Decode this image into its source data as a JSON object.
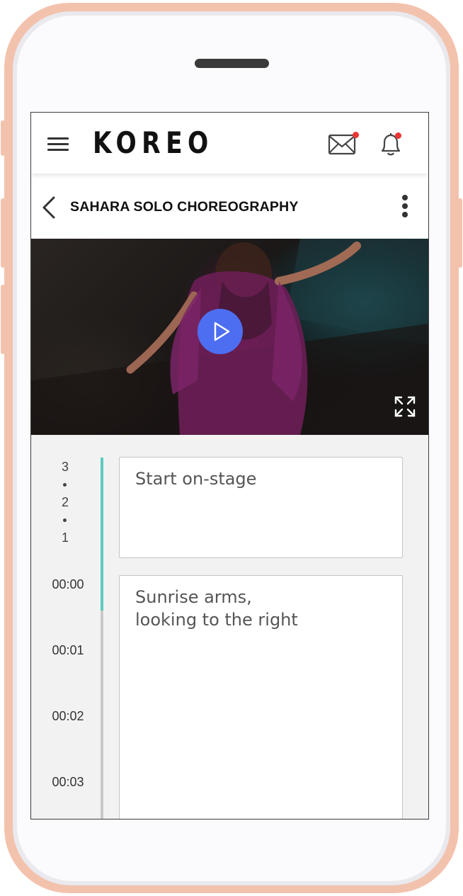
{
  "app": {
    "logo": "KOREO",
    "brand_color": "#111111"
  },
  "header": {
    "menu_icon": "hamburger-icon",
    "mail_icon": "mail-icon",
    "bell_icon": "bell-icon",
    "notification_dot_color": "#ea3535"
  },
  "page": {
    "title": "SAHARA SOLO CHOREOGRAPHY",
    "back_icon": "chevron-left-icon",
    "more_icon": "more-vertical-icon"
  },
  "video": {
    "play_icon": "play-icon",
    "fullscreen_icon": "expand-icon",
    "accent_color": "#4d6ef1"
  },
  "timeline": {
    "countdown": [
      "3",
      "2",
      "1"
    ],
    "timestamps": [
      "00:00",
      "00:01",
      "00:02",
      "00:03"
    ],
    "active_color": "#5dcbbf",
    "notes": [
      {
        "text": "Start on-stage"
      },
      {
        "text": "Sunrise arms,\nlooking to the right"
      }
    ]
  }
}
